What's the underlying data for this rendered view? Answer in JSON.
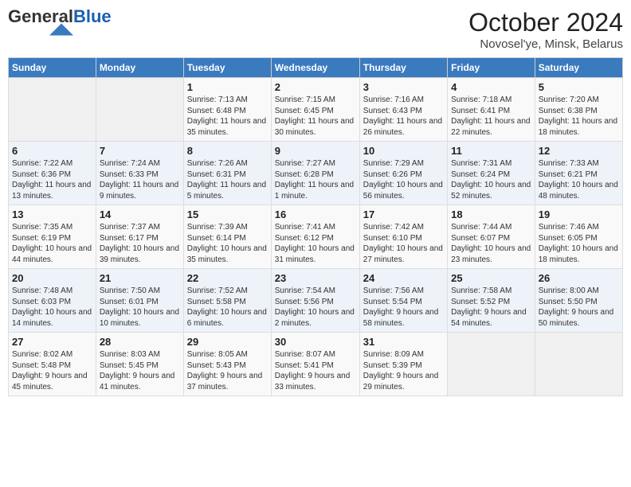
{
  "header": {
    "logo_general": "General",
    "logo_blue": "Blue",
    "month_title": "October 2024",
    "location": "Novosel'ye, Minsk, Belarus"
  },
  "days_of_week": [
    "Sunday",
    "Monday",
    "Tuesday",
    "Wednesday",
    "Thursday",
    "Friday",
    "Saturday"
  ],
  "weeks": [
    [
      {
        "day": "",
        "empty": true
      },
      {
        "day": "",
        "empty": true
      },
      {
        "day": "1",
        "sunrise": "Sunrise: 7:13 AM",
        "sunset": "Sunset: 6:48 PM",
        "daylight": "Daylight: 11 hours and 35 minutes."
      },
      {
        "day": "2",
        "sunrise": "Sunrise: 7:15 AM",
        "sunset": "Sunset: 6:45 PM",
        "daylight": "Daylight: 11 hours and 30 minutes."
      },
      {
        "day": "3",
        "sunrise": "Sunrise: 7:16 AM",
        "sunset": "Sunset: 6:43 PM",
        "daylight": "Daylight: 11 hours and 26 minutes."
      },
      {
        "day": "4",
        "sunrise": "Sunrise: 7:18 AM",
        "sunset": "Sunset: 6:41 PM",
        "daylight": "Daylight: 11 hours and 22 minutes."
      },
      {
        "day": "5",
        "sunrise": "Sunrise: 7:20 AM",
        "sunset": "Sunset: 6:38 PM",
        "daylight": "Daylight: 11 hours and 18 minutes."
      }
    ],
    [
      {
        "day": "6",
        "sunrise": "Sunrise: 7:22 AM",
        "sunset": "Sunset: 6:36 PM",
        "daylight": "Daylight: 11 hours and 13 minutes."
      },
      {
        "day": "7",
        "sunrise": "Sunrise: 7:24 AM",
        "sunset": "Sunset: 6:33 PM",
        "daylight": "Daylight: 11 hours and 9 minutes."
      },
      {
        "day": "8",
        "sunrise": "Sunrise: 7:26 AM",
        "sunset": "Sunset: 6:31 PM",
        "daylight": "Daylight: 11 hours and 5 minutes."
      },
      {
        "day": "9",
        "sunrise": "Sunrise: 7:27 AM",
        "sunset": "Sunset: 6:28 PM",
        "daylight": "Daylight: 11 hours and 1 minute."
      },
      {
        "day": "10",
        "sunrise": "Sunrise: 7:29 AM",
        "sunset": "Sunset: 6:26 PM",
        "daylight": "Daylight: 10 hours and 56 minutes."
      },
      {
        "day": "11",
        "sunrise": "Sunrise: 7:31 AM",
        "sunset": "Sunset: 6:24 PM",
        "daylight": "Daylight: 10 hours and 52 minutes."
      },
      {
        "day": "12",
        "sunrise": "Sunrise: 7:33 AM",
        "sunset": "Sunset: 6:21 PM",
        "daylight": "Daylight: 10 hours and 48 minutes."
      }
    ],
    [
      {
        "day": "13",
        "sunrise": "Sunrise: 7:35 AM",
        "sunset": "Sunset: 6:19 PM",
        "daylight": "Daylight: 10 hours and 44 minutes."
      },
      {
        "day": "14",
        "sunrise": "Sunrise: 7:37 AM",
        "sunset": "Sunset: 6:17 PM",
        "daylight": "Daylight: 10 hours and 39 minutes."
      },
      {
        "day": "15",
        "sunrise": "Sunrise: 7:39 AM",
        "sunset": "Sunset: 6:14 PM",
        "daylight": "Daylight: 10 hours and 35 minutes."
      },
      {
        "day": "16",
        "sunrise": "Sunrise: 7:41 AM",
        "sunset": "Sunset: 6:12 PM",
        "daylight": "Daylight: 10 hours and 31 minutes."
      },
      {
        "day": "17",
        "sunrise": "Sunrise: 7:42 AM",
        "sunset": "Sunset: 6:10 PM",
        "daylight": "Daylight: 10 hours and 27 minutes."
      },
      {
        "day": "18",
        "sunrise": "Sunrise: 7:44 AM",
        "sunset": "Sunset: 6:07 PM",
        "daylight": "Daylight: 10 hours and 23 minutes."
      },
      {
        "day": "19",
        "sunrise": "Sunrise: 7:46 AM",
        "sunset": "Sunset: 6:05 PM",
        "daylight": "Daylight: 10 hours and 18 minutes."
      }
    ],
    [
      {
        "day": "20",
        "sunrise": "Sunrise: 7:48 AM",
        "sunset": "Sunset: 6:03 PM",
        "daylight": "Daylight: 10 hours and 14 minutes."
      },
      {
        "day": "21",
        "sunrise": "Sunrise: 7:50 AM",
        "sunset": "Sunset: 6:01 PM",
        "daylight": "Daylight: 10 hours and 10 minutes."
      },
      {
        "day": "22",
        "sunrise": "Sunrise: 7:52 AM",
        "sunset": "Sunset: 5:58 PM",
        "daylight": "Daylight: 10 hours and 6 minutes."
      },
      {
        "day": "23",
        "sunrise": "Sunrise: 7:54 AM",
        "sunset": "Sunset: 5:56 PM",
        "daylight": "Daylight: 10 hours and 2 minutes."
      },
      {
        "day": "24",
        "sunrise": "Sunrise: 7:56 AM",
        "sunset": "Sunset: 5:54 PM",
        "daylight": "Daylight: 9 hours and 58 minutes."
      },
      {
        "day": "25",
        "sunrise": "Sunrise: 7:58 AM",
        "sunset": "Sunset: 5:52 PM",
        "daylight": "Daylight: 9 hours and 54 minutes."
      },
      {
        "day": "26",
        "sunrise": "Sunrise: 8:00 AM",
        "sunset": "Sunset: 5:50 PM",
        "daylight": "Daylight: 9 hours and 50 minutes."
      }
    ],
    [
      {
        "day": "27",
        "sunrise": "Sunrise: 8:02 AM",
        "sunset": "Sunset: 5:48 PM",
        "daylight": "Daylight: 9 hours and 45 minutes."
      },
      {
        "day": "28",
        "sunrise": "Sunrise: 8:03 AM",
        "sunset": "Sunset: 5:45 PM",
        "daylight": "Daylight: 9 hours and 41 minutes."
      },
      {
        "day": "29",
        "sunrise": "Sunrise: 8:05 AM",
        "sunset": "Sunset: 5:43 PM",
        "daylight": "Daylight: 9 hours and 37 minutes."
      },
      {
        "day": "30",
        "sunrise": "Sunrise: 8:07 AM",
        "sunset": "Sunset: 5:41 PM",
        "daylight": "Daylight: 9 hours and 33 minutes."
      },
      {
        "day": "31",
        "sunrise": "Sunrise: 8:09 AM",
        "sunset": "Sunset: 5:39 PM",
        "daylight": "Daylight: 9 hours and 29 minutes."
      },
      {
        "day": "",
        "empty": true
      },
      {
        "day": "",
        "empty": true
      }
    ]
  ]
}
